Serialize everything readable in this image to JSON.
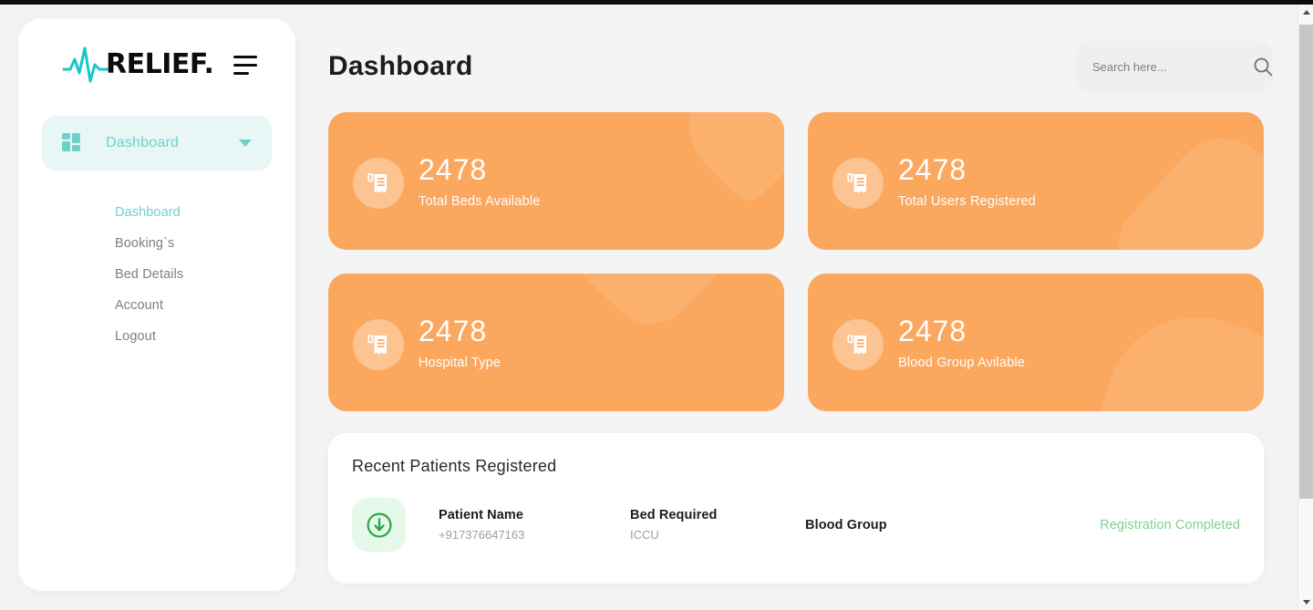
{
  "brand": {
    "logo_icon": "heartbeat-ekg-icon",
    "name": "RELIEF.",
    "menu_icon": "hamburger-menu-icon"
  },
  "sidebar": {
    "active_nav": {
      "icon": "grid-dashboard-icon",
      "label": "Dashboard",
      "caret_icon": "chevron-down-icon"
    },
    "items": [
      {
        "label": "Dashboard",
        "active": true
      },
      {
        "label": "Booking`s",
        "active": false
      },
      {
        "label": "Bed Details",
        "active": false
      },
      {
        "label": "Account",
        "active": false
      },
      {
        "label": "Logout",
        "active": false
      }
    ]
  },
  "header": {
    "title": "Dashboard",
    "search": {
      "placeholder": "Search here...",
      "value": "",
      "icon": "search-icon"
    }
  },
  "stats": {
    "cards": [
      {
        "value": "2478",
        "label": "Total Beds Available",
        "icon": "receipt-icon",
        "deco": "deco-heart"
      },
      {
        "value": "2478",
        "label": "Total Users Registered",
        "icon": "receipt-icon",
        "deco": "deco-square"
      },
      {
        "value": "2478",
        "label": "Hospital Type",
        "icon": "receipt-icon",
        "deco": "deco-top"
      },
      {
        "value": "2478",
        "label": "Blood Group Avilable",
        "icon": "receipt-icon",
        "deco": "deco-hill"
      }
    ]
  },
  "recent_patients": {
    "title": "Recent Patients Registered",
    "rows": [
      {
        "icon": "arrow-down-circle-icon",
        "name_label": "Patient Name",
        "phone": "+917376647163",
        "bed_label": "Bed Required",
        "bed_value": "ICCU",
        "blood_label": "Blood Group",
        "status": "Registration Completed"
      }
    ]
  },
  "colors": {
    "accent_teal": "#6fd0cb",
    "card_orange": "#fba75e",
    "status_green": "#7fd18a",
    "page_bg": "#f4f4f4"
  },
  "scrollbar": {
    "up_icon": "scroll-up-arrow-icon",
    "down_icon": "scroll-down-arrow-icon"
  }
}
